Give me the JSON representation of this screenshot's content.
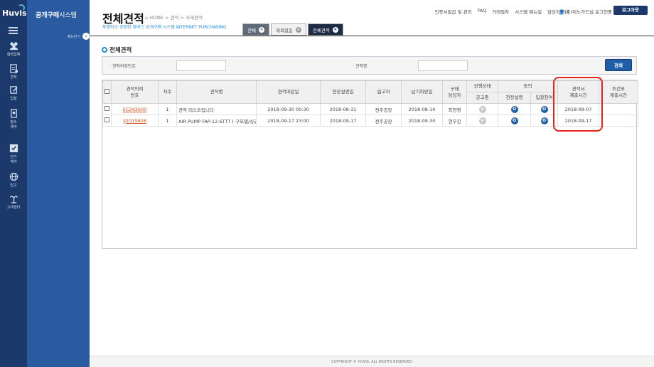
{
  "brand": {
    "logo": "Huvis",
    "system_name_bold": "공개구매",
    "system_name_light": "시스템"
  },
  "rail": [
    {
      "label": "협력업체",
      "icon": "partners-icon"
    },
    {
      "label": "견적",
      "icon": "quote-icon"
    },
    {
      "label": "입찰",
      "icon": "bid-icon"
    },
    {
      "label": "협수\n계약",
      "icon": "contract-icon"
    },
    {
      "label": "단가\n계약",
      "icon": "unit-price-contract-icon"
    },
    {
      "label": "입고",
      "icon": "globe-icon"
    },
    {
      "label": "고객센터",
      "icon": "customer-center-icon"
    }
  ],
  "sidebar": {
    "menu_close_label": "메뉴닫기"
  },
  "header": {
    "title": "전체견적",
    "breadcrumb": "HOME > 견적 > 자재견적",
    "subtitle": "투명하고 공정한 휴비스 공개구매 시스템 INTERNET PURCHASING",
    "links": [
      "인증서발급 및 관리",
      "FAQ",
      "거래절차",
      "시스템 매뉴얼",
      "담당자안내"
    ],
    "user": "(주)이노가드님 로그인중",
    "logout_label": "로그아웃"
  },
  "tabs": [
    {
      "label": "전체"
    },
    {
      "label": "제목없음"
    },
    {
      "label": "전체견적"
    }
  ],
  "section_title": "전체견적",
  "search": {
    "field1_label": "· 견적의뢰번호",
    "field1_value": "",
    "field2_label": "· 견적명",
    "field2_value": "",
    "button_label": "검색"
  },
  "table": {
    "headers": {
      "request_no": "견적의뢰\n번호",
      "round": "차수",
      "name": "견적명",
      "deadline": "견적마감일",
      "site_date": "현장설명일",
      "warehouse": "입고처",
      "delivery": "납기희망일",
      "buyer": "구매\n담당자",
      "status_group": "진행상태",
      "status_sub": "공고중",
      "agree_group": "동의",
      "agree_site": "현장설명",
      "agree_bid": "입찰참여",
      "submit_time": "견적서\n제출시간",
      "condition_time": "조건표\n제출시간"
    },
    "rows": [
      {
        "request_no": "EC243600",
        "round": "1",
        "name": "견적 테스트입니다",
        "deadline": "2018-09-30 00:30",
        "site_date": "2018-08-31",
        "warehouse": "전주공장",
        "delivery": "2018-08-10",
        "buyer": "최현영",
        "status": "V",
        "agree_site": "O",
        "agree_bid": "O",
        "submit_time": "2018-09-07",
        "condition_time": ""
      },
      {
        "request_no": "IJ2015928",
        "round": "1",
        "name": "AIR PUMP  FAP-12-6TTT ( 구모델/싱글",
        "deadline": "2018-09-17 23:00",
        "site_date": "2018-09-17",
        "warehouse": "전주공장",
        "delivery": "2018-09-30",
        "buyer": "현우진",
        "status": "V",
        "agree_site": "O",
        "agree_bid": "O",
        "submit_time": "2018-09-17",
        "condition_time": ""
      }
    ]
  },
  "footer": "COPYRIGHT © HUVIS. ALL RIGHTS RESERVED",
  "colors": {
    "rail": "#1b3a6b",
    "sidebar": "#2a5aa0",
    "accent": "#2a8ad6",
    "link": "#d0511f",
    "highlight": "#e2241c"
  }
}
